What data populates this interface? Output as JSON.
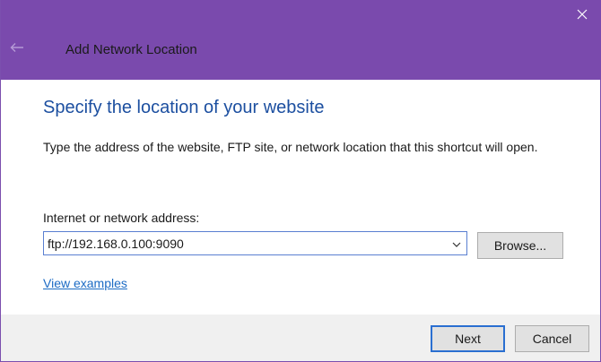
{
  "window": {
    "title": "Add Network Location",
    "titlebar_color": "#7a4aad",
    "icons": {
      "back": "back-arrow-icon",
      "close": "close-icon",
      "dropdown": "chevron-down-icon"
    }
  },
  "main": {
    "heading": "Specify the location of your website",
    "description": "Type the address of the website, FTP site, or network location that this shortcut will open.",
    "address": {
      "label": "Internet or network address:",
      "value": "ftp://192.168.0.100:9090"
    },
    "browse_label": "Browse...",
    "view_examples_label": "View examples",
    "heading_color": "#1c4fa0",
    "link_color": "#1c6bc4"
  },
  "footer": {
    "next_label": "Next",
    "cancel_label": "Cancel"
  }
}
